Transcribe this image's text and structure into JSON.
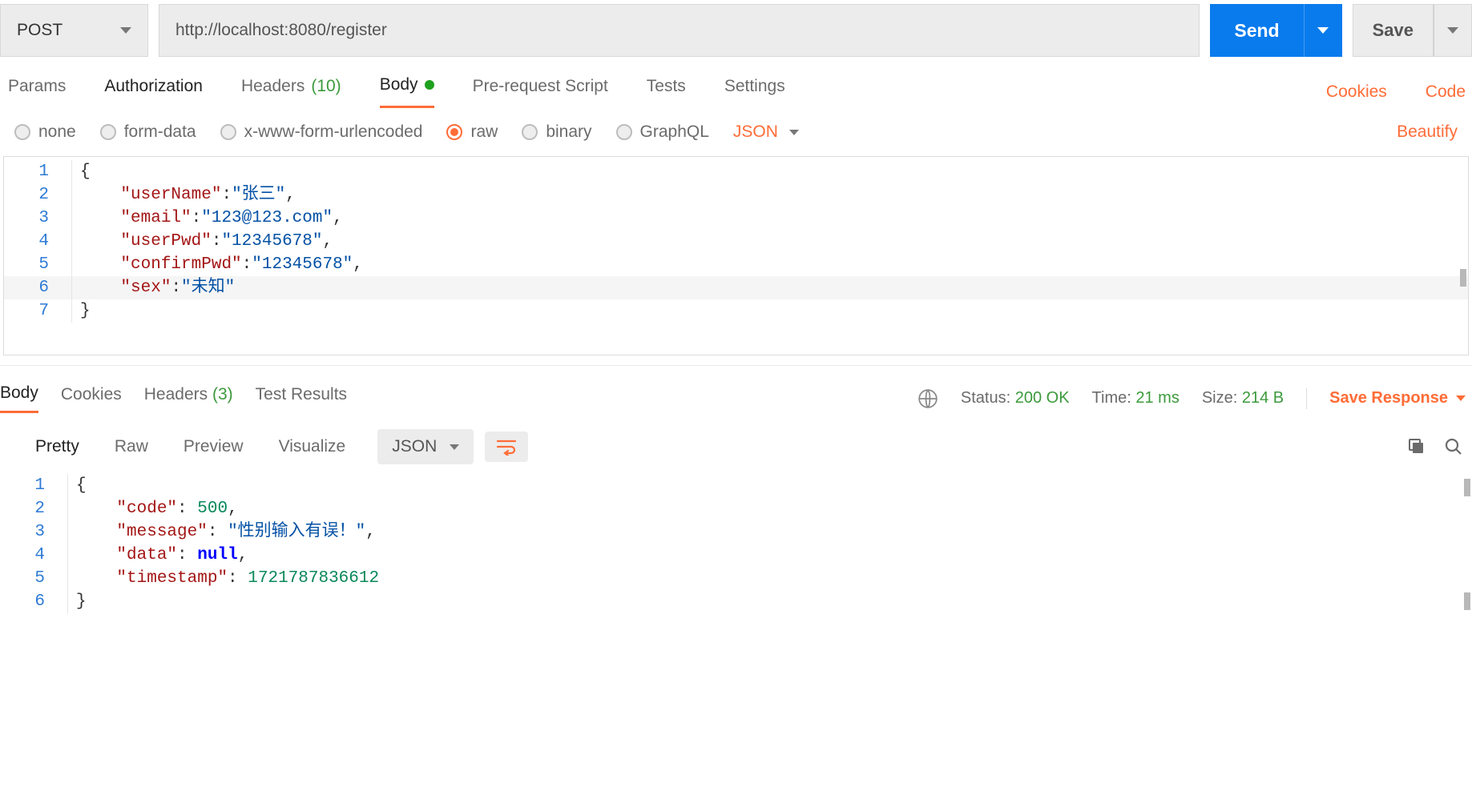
{
  "request": {
    "method": "POST",
    "url": "http://localhost:8080/register",
    "send_label": "Send",
    "save_label": "Save"
  },
  "req_tabs": {
    "params": "Params",
    "authorization": "Authorization",
    "headers_label": "Headers",
    "headers_count": "(10)",
    "body": "Body",
    "prerequest": "Pre-request Script",
    "tests": "Tests",
    "settings": "Settings",
    "cookies": "Cookies",
    "code": "Code"
  },
  "body_types": {
    "none": "none",
    "form_data": "form-data",
    "urlencoded": "x-www-form-urlencoded",
    "raw": "raw",
    "binary": "binary",
    "graphql": "GraphQL",
    "format": "JSON",
    "beautify": "Beautify"
  },
  "request_body": {
    "line1": "{",
    "k_userName": "\"userName\"",
    "v_userName": "\"张三\"",
    "k_email": "\"email\"",
    "v_email": "\"123@123.com\"",
    "k_userPwd": "\"userPwd\"",
    "v_userPwd": "\"12345678\"",
    "k_confirmPwd": "\"confirmPwd\"",
    "v_confirmPwd": "\"12345678\"",
    "k_sex": "\"sex\"",
    "v_sex": "\"未知\"",
    "line7": "}",
    "ln": {
      "1": "1",
      "2": "2",
      "3": "3",
      "4": "4",
      "5": "5",
      "6": "6",
      "7": "7"
    }
  },
  "resp_tabs": {
    "body": "Body",
    "cookies": "Cookies",
    "headers_label": "Headers",
    "headers_count": "(3)",
    "test_results": "Test Results"
  },
  "resp_meta": {
    "status_label": "Status:",
    "status_val": "200 OK",
    "time_label": "Time:",
    "time_val": "21 ms",
    "size_label": "Size:",
    "size_val": "214 B",
    "save_response": "Save Response"
  },
  "resp_views": {
    "pretty": "Pretty",
    "raw": "Raw",
    "preview": "Preview",
    "visualize": "Visualize",
    "format": "JSON"
  },
  "response_body": {
    "line1": "{",
    "k_code": "\"code\"",
    "v_code": "500",
    "k_message": "\"message\"",
    "v_message": "\"性别输入有误！\"",
    "k_data": "\"data\"",
    "v_data": "null",
    "k_timestamp": "\"timestamp\"",
    "v_timestamp": "1721787836612",
    "line6": "}",
    "ln": {
      "1": "1",
      "2": "2",
      "3": "3",
      "4": "4",
      "5": "5",
      "6": "6"
    }
  }
}
